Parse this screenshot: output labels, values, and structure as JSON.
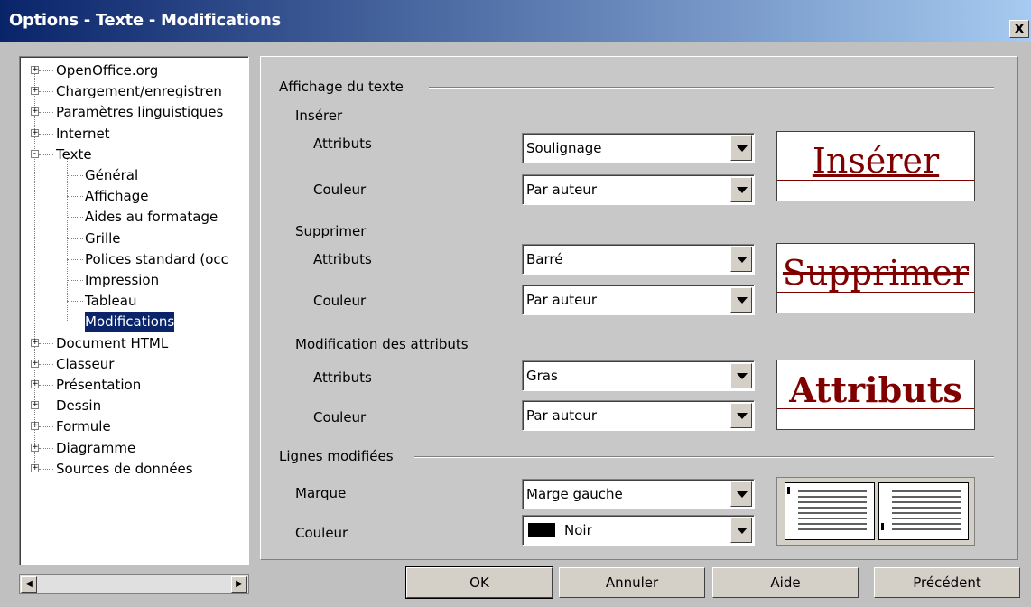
{
  "window": {
    "title": "Options - Texte - Modifications",
    "close_label": "x"
  },
  "tree": {
    "items": [
      {
        "label": "OpenOffice.org",
        "level": 0,
        "expander": "+"
      },
      {
        "label": "Chargement/enregistren",
        "level": 0,
        "expander": "+"
      },
      {
        "label": "Paramètres linguistiques",
        "level": 0,
        "expander": "+"
      },
      {
        "label": "Internet",
        "level": 0,
        "expander": "+"
      },
      {
        "label": "Texte",
        "level": 0,
        "expander": "-"
      },
      {
        "label": "Général",
        "level": 1
      },
      {
        "label": "Affichage",
        "level": 1
      },
      {
        "label": "Aides au formatage",
        "level": 1
      },
      {
        "label": "Grille",
        "level": 1
      },
      {
        "label": "Polices standard (occ",
        "level": 1
      },
      {
        "label": "Impression",
        "level": 1
      },
      {
        "label": "Tableau",
        "level": 1
      },
      {
        "label": "Modifications",
        "level": 1,
        "selected": true
      },
      {
        "label": "Document HTML",
        "level": 0,
        "expander": "+"
      },
      {
        "label": "Classeur",
        "level": 0,
        "expander": "+"
      },
      {
        "label": "Présentation",
        "level": 0,
        "expander": "+"
      },
      {
        "label": "Dessin",
        "level": 0,
        "expander": "+"
      },
      {
        "label": "Formule",
        "level": 0,
        "expander": "+"
      },
      {
        "label": "Diagramme",
        "level": 0,
        "expander": "+"
      },
      {
        "label": "Sources de données",
        "level": 0,
        "expander": "+"
      }
    ],
    "scroll_left_icon": "arrow-left-icon",
    "scroll_right_icon": "arrow-right-icon"
  },
  "display": {
    "section_label": "Affichage du texte",
    "insert": {
      "label": "Insérer",
      "attr_label": "Attributs",
      "attr_value": "Soulignage",
      "color_label": "Couleur",
      "color_value": "Par auteur",
      "preview_text": "Insérer"
    },
    "delete": {
      "label": "Supprimer",
      "attr_label": "Attributs",
      "attr_value": "Barré",
      "color_label": "Couleur",
      "color_value": "Par auteur",
      "preview_text": "Supprimer"
    },
    "changed": {
      "label": "Modification des attributs",
      "attr_label": "Attributs",
      "attr_value": "Gras",
      "color_label": "Couleur",
      "color_value": "Par auteur",
      "preview_text": "Attributs"
    }
  },
  "lines": {
    "section_label": "Lignes modifiées",
    "mark_label": "Marque",
    "mark_value": "Marge gauche",
    "color_label": "Couleur",
    "color_value": "Noir",
    "color_swatch": "#000000"
  },
  "buttons": {
    "ok": "OK",
    "cancel": "Annuler",
    "help": "Aide",
    "back": "Précédent"
  },
  "colors": {
    "title_start": "#0a246a",
    "title_end": "#a6caf0",
    "preview_text": "#800000",
    "selection": "#0a246a"
  }
}
